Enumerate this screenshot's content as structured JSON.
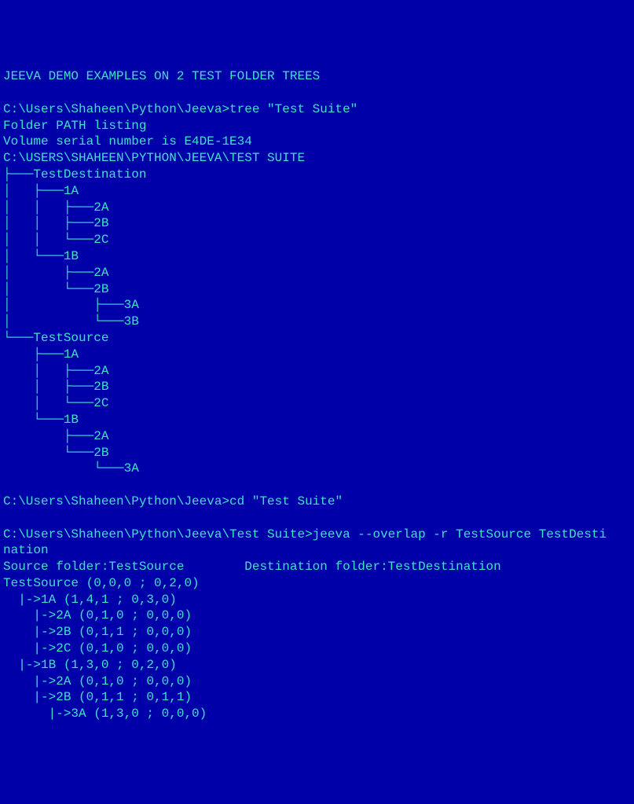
{
  "lines": [
    "JEEVA DEMO EXAMPLES ON 2 TEST FOLDER TREES",
    "",
    "C:\\Users\\Shaheen\\Python\\Jeeva>tree \"Test Suite\"",
    "Folder PATH listing",
    "Volume serial number is E4DE-1E34",
    "C:\\USERS\\SHAHEEN\\PYTHON\\JEEVA\\TEST SUITE",
    "├───TestDestination",
    "│   ├───1A",
    "│   │   ├───2A",
    "│   │   ├───2B",
    "│   │   └───2C",
    "│   └───1B",
    "│       ├───2A",
    "│       └───2B",
    "│           ├───3A",
    "│           └───3B",
    "└───TestSource",
    "    ├───1A",
    "    │   ├───2A",
    "    │   ├───2B",
    "    │   └───2C",
    "    └───1B",
    "        ├───2A",
    "        └───2B",
    "            └───3A",
    "",
    "C:\\Users\\Shaheen\\Python\\Jeeva>cd \"Test Suite\"",
    "",
    "C:\\Users\\Shaheen\\Python\\Jeeva\\Test Suite>jeeva --overlap -r TestSource TestDesti",
    "nation",
    "Source folder:TestSource        Destination folder:TestDestination",
    "TestSource (0,0,0 ; 0,2,0)",
    "  |->1A (1,4,1 ; 0,3,0)",
    "    |->2A (0,1,0 ; 0,0,0)",
    "    |->2B (0,1,1 ; 0,0,0)",
    "    |->2C (0,1,0 ; 0,0,0)",
    "  |->1B (1,3,0 ; 0,2,0)",
    "    |->2A (0,1,0 ; 0,0,0)",
    "    |->2B (0,1,1 ; 0,1,1)",
    "      |->3A (1,3,0 ; 0,0,0)"
  ]
}
